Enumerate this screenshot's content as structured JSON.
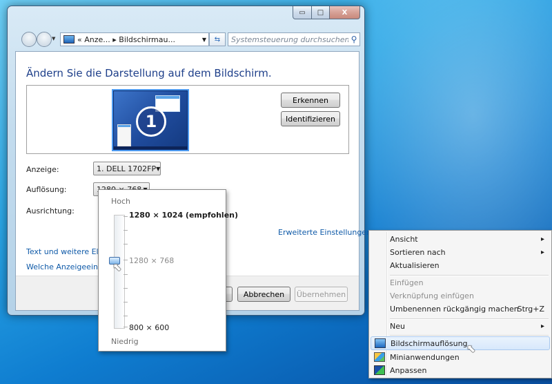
{
  "window": {
    "caption_min": "▭",
    "caption_max": "□",
    "caption_close": "X",
    "address": "« Anze... ▸ Bildschirmau...",
    "search_placeholder": "Systemsteuerung durchsuchen",
    "heading": "Ändern Sie die Darstellung auf dem Bildschirm.",
    "monitor_number": "1",
    "detect_button": "Erkennen",
    "identify_button": "Identifizieren",
    "display_label": "Anzeige:",
    "display_value": "1. DELL 1702FP",
    "resolution_label": "Auflösung:",
    "resolution_value": "1280 × 768",
    "orientation_label": "Ausrichtung:",
    "advanced_link": "Erweiterte Einstellungen",
    "link_text_elements": "Text und weitere Elem",
    "link_which_display": "Welche Anzeigeeinste",
    "ok_button": "",
    "cancel_button": "Abbrechen",
    "apply_button": "Übernehmen"
  },
  "resolution_popup": {
    "high_label": "Hoch",
    "low_label": "Niedrig",
    "top_option": "1280 × 1024 (empfohlen)",
    "current_option": "1280 × 768",
    "bottom_option": "800 × 600"
  },
  "context_menu": {
    "items": [
      {
        "label": "Ansicht",
        "arrow": "▸"
      },
      {
        "label": "Sortieren nach",
        "arrow": "▸"
      },
      {
        "label": "Aktualisieren"
      },
      {
        "label": "Einfügen"
      },
      {
        "label": "Verknüpfung einfügen"
      },
      {
        "label": "Umbenennen rückgängig machen",
        "shortcut": "Strg+Z"
      },
      {
        "label": "Neu",
        "arrow": "▸"
      },
      {
        "label": "Bildschirmauflösung"
      },
      {
        "label": "Minianwendungen"
      },
      {
        "label": "Anpassen"
      }
    ]
  },
  "colors": {
    "accent_link": "#0f5aa8",
    "heading_blue": "#1e3f8a",
    "desktop_blue": "#0f7dd0"
  }
}
